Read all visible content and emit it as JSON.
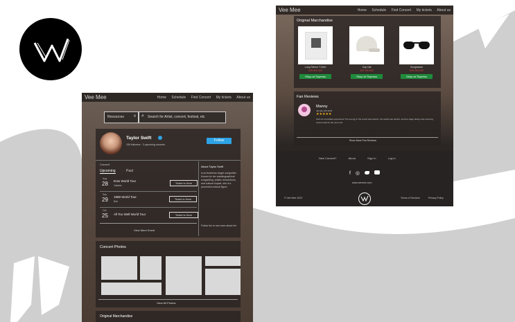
{
  "brand": "Vee Mee",
  "nav_links": [
    "Home",
    "Schedule",
    "Find Concert",
    "My tickets",
    "About us"
  ],
  "search": {
    "dropdown_label": "Resources",
    "placeholder": "Search for Artist, concert, festival, etc"
  },
  "artist": {
    "name": "Taylor Swift",
    "followers": "150 followers · 3 upcoming concerts",
    "follow_label": "Follow",
    "concert_label": "Concert",
    "tabs": [
      "Upcoming",
      "Past"
    ],
    "concerts": [
      {
        "month": "Aug",
        "day": "28",
        "title": "Eras World Tour",
        "sub": "Jakarta",
        "action": "Ticket is Here"
      },
      {
        "month": "Sep",
        "day": "29",
        "title": "1989 World Tour",
        "sub": "Bali",
        "action": "Ticket is Here"
      },
      {
        "month": "Oct",
        "day": "25",
        "title": "All Too Well World Tour",
        "sub": "",
        "action": "Ticket is Here"
      }
    ],
    "view_more": "View More Event",
    "about_title": "About Taylor Swift",
    "about_text": "is an American singer-songwriter. Known for her autobiographical songwriting, artistic reinventions, and cultural impact, she is a prominent cultural figure.",
    "about_more": "Follow her to see more about her"
  },
  "photos": {
    "title": "Concert Photos",
    "view_all": "View All Photos"
  },
  "merch": {
    "title": "Original Marchandise",
    "items": [
      {
        "name": "Long Sleeve T-Shirt",
        "price": "IDR 500,000",
        "action": "Shop at Tixpress"
      },
      {
        "name": "Cap Hat",
        "price": "IDR 150,000",
        "action": "Shop at Tixpress"
      },
      {
        "name": "Sunglasses",
        "price": "IDR 250,000",
        "action": "Shop at Tixpress"
      }
    ]
  },
  "reviews": {
    "title": "Fan Reviews",
    "reviewer": "Manny",
    "date": "January 9th 2023",
    "stars": "★★★★★",
    "text": "Such an incredible experience! The energy in the crowd was electric, the setlist was perfect, and the stage design was stunning. Cannot wait for the next one!",
    "show_more": "Show More Fan Reviews"
  },
  "footer": {
    "links": [
      "New Concert?",
      "About",
      "Sign In",
      "Log In"
    ],
    "socials": [
      "f",
      "◎",
      "🐦",
      "▶"
    ],
    "site": "www.veemee.com",
    "copyright": "© Vee Mee 2023",
    "legal": [
      "Terms of Services",
      "Privacy Policy"
    ]
  },
  "colors": {
    "follow": "#2ea3e6",
    "shop": "#1f8a3c",
    "price": "#d12a2a",
    "footer_bg": "#262322"
  }
}
